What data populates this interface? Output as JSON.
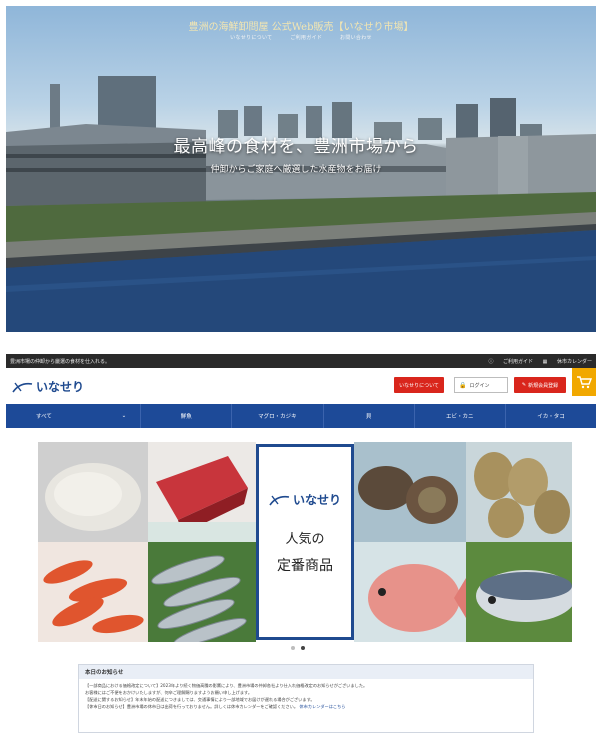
{
  "hero": {
    "top_title": "豊洲の海鮮卸問屋 公式Web販売【いなせり市場】",
    "top_links": [
      "いなせりについて",
      "ご利用ガイド",
      "お問い合わせ"
    ],
    "title": "最高峰の食材を、豊洲市場から",
    "subtitle": "仲卸からご家庭へ厳選した水産物をお届け"
  },
  "shop": {
    "topbar": {
      "tagline": "豊洲市場の仲卸から厳選の食材を仕入れる。",
      "links": [
        "ご利用ガイド",
        "休市カレンダー"
      ]
    },
    "logo": {
      "text": "いなせり"
    },
    "header": {
      "about_button": "いなせりについて",
      "login_label": "ログイン",
      "register_button": "新規会員登録"
    },
    "nav": [
      "すべて",
      "鮮魚",
      "マグロ・カジキ",
      "貝",
      "エビ・カニ",
      "イカ・タコ"
    ],
    "banner": {
      "logo_text": "いなせり",
      "line1": "人気の",
      "line2": "定番商品"
    },
    "notice": {
      "heading": "本日のお知らせ",
      "lines": [
        "【一部商品における価格改定について】2023年より続く物価高騰の影響により、豊洲市場の仲卸各社より仕入れ価格改定のお知らせがございました。",
        "お客様にはご不便をおかけいたしますが、何卒ご理解賜りますようお願い申し上げます。",
        "【配送に関するお知らせ】年末年始の配送につきましては、交通事情により一部地域でお届けが遅れる場合がございます。",
        "【休市日のお知らせ】豊洲市場の休市日は出荷を行っておりません。詳しくは休市カレンダーをご確認ください。"
      ],
      "link": "休市カレンダーはこちら"
    }
  }
}
